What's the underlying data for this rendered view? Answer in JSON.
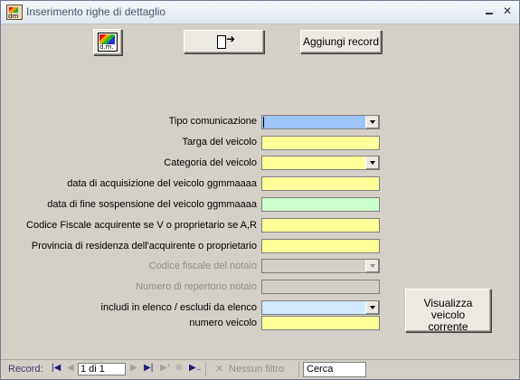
{
  "window": {
    "title": "Inserimento righe di dettaglio"
  },
  "toolbar": {
    "add_record_label": "Aggiungi record"
  },
  "form": {
    "fields": [
      {
        "label": "Tipo comunicazione"
      },
      {
        "label": "Targa del veicolo"
      },
      {
        "label": "Categoria del veicolo"
      },
      {
        "label": "data di acquisizione del veicolo ggmmaaaa"
      },
      {
        "label": "data di fine sospensione del veicolo ggmmaaaa"
      },
      {
        "label": "Codice Fiscale acquirente se V o proprietario se A,R"
      },
      {
        "label": "Provincia di residenza dell'acquirente o proprietario"
      },
      {
        "label": "Codice fiscale del notaio"
      },
      {
        "label": "Numero di repertorio notaio"
      },
      {
        "label": "includi in elenco / escludi da elenco"
      },
      {
        "label": "numero veicolo"
      }
    ],
    "view_button_line1": "Visualizza veicolo",
    "view_button_line2": "corrente"
  },
  "statusbar": {
    "record_label": "Record:",
    "record_position": "1 di 1",
    "filter_label": "Nessun filtro",
    "search_placeholder": "Cerca"
  },
  "colors": {
    "yellow_field": "#ffff99",
    "blue_field": "#9dc3f7",
    "green_field": "#ccffcc",
    "cyan_field": "#cfe9ff"
  }
}
